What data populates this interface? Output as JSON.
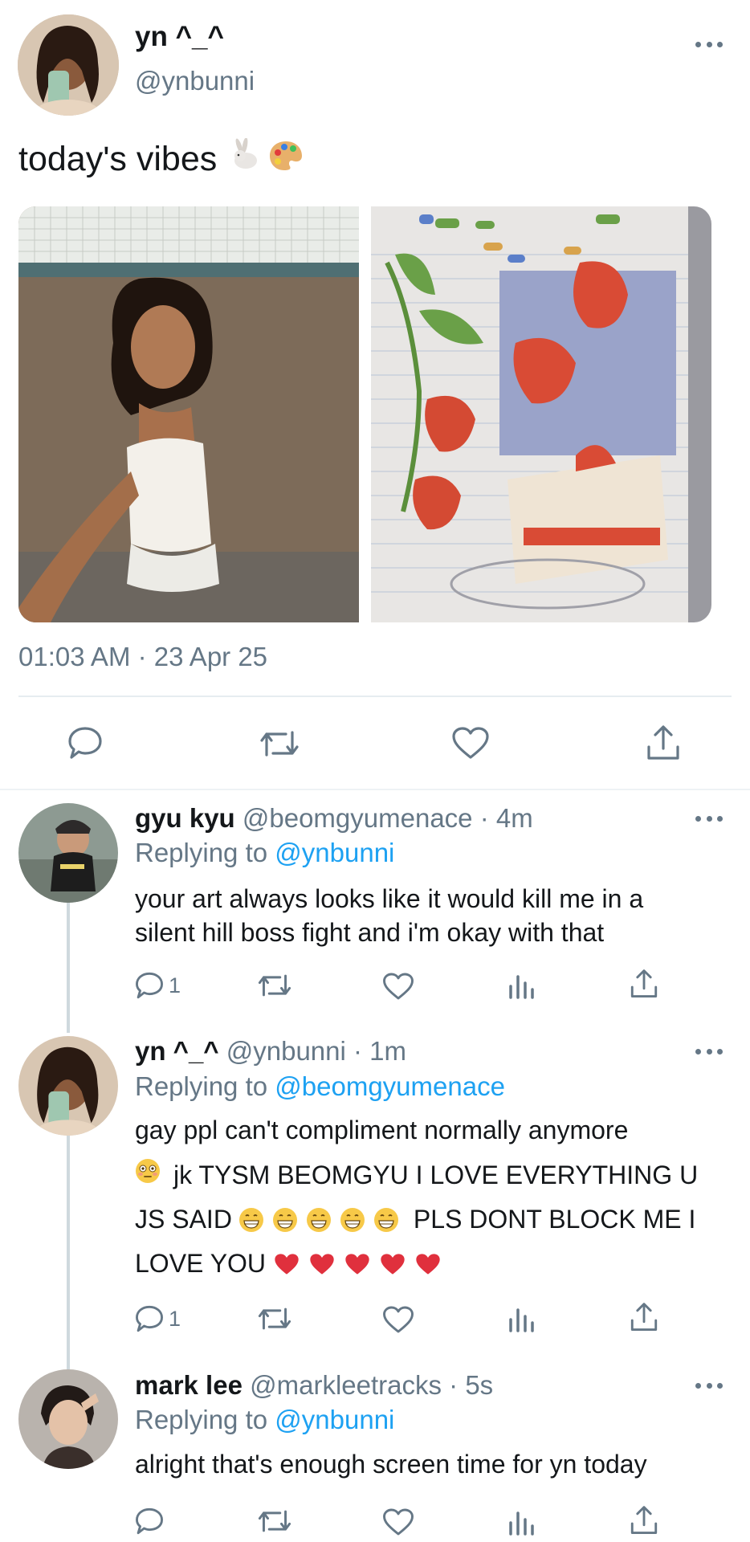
{
  "main_tweet": {
    "display_name": "yn ^_^",
    "handle": "@ynbunni",
    "text": "today's vibes",
    "emojis": [
      "rabbit-emoji",
      "palette-emoji"
    ],
    "timestamp": "01:03 AM · 23 Apr 25"
  },
  "replies": [
    {
      "display_name": "gyu kyu",
      "handle_time": "@beomgyumenace · 4m",
      "replying_prefix": "Replying to",
      "replying_to": "@ynbunni",
      "text_line1": "your art always looks like it would kill me in a",
      "text_line2": "silent hill boss fight and i'm okay with that",
      "reply_count": "1"
    },
    {
      "display_name": "yn ^_^",
      "handle_time": "@ynbunni · 1m",
      "replying_prefix": "Replying to",
      "replying_to": "@beomgyumenace",
      "text_line1": "gay ppl can't compliment normally anymore",
      "text_line2": "jk TYSM BEOMGYU I LOVE EVERYTHING U",
      "text_line3a": "JS SAID",
      "text_line3b": "PLS DONT BLOCK ME I",
      "text_line4": "LOVE YOU",
      "reply_count": "1"
    },
    {
      "display_name": "mark lee",
      "handle_time": "@markleetracks · 5s",
      "replying_prefix": "Replying to",
      "replying_to": "@ynbunni",
      "text_line1": "alright that's enough screen time for yn today"
    }
  ],
  "colors": {
    "text": "#14171a",
    "muted": "#657786",
    "link": "#1da1f2",
    "divider": "#e6ecf0",
    "thread_line": "#cfd9de",
    "heart": "#e0245e"
  }
}
